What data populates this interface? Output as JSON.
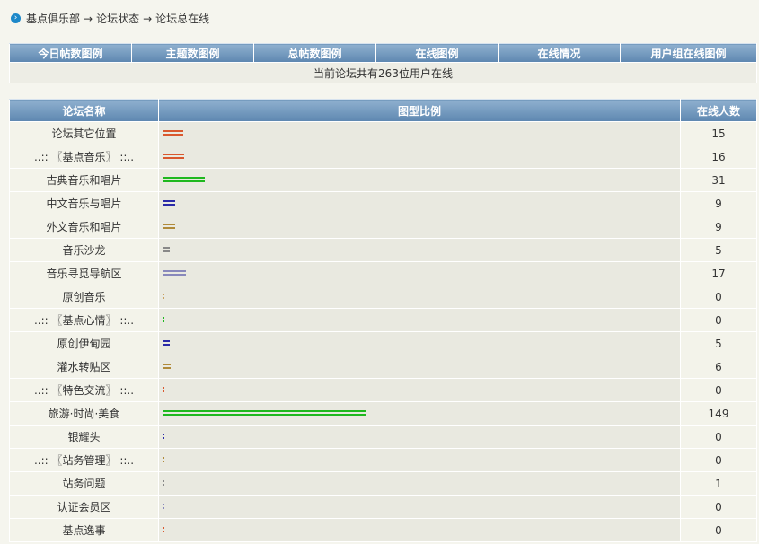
{
  "breadcrumb": {
    "items": [
      "基点俱乐部",
      "论坛状态",
      "论坛总在线"
    ],
    "arrow": "→"
  },
  "nav": {
    "tabs": [
      "今日帖数图例",
      "主题数图例",
      "总帖数图例",
      "在线图例",
      "在线情况",
      "用户组在线图例"
    ],
    "summary": "当前论坛共有263位用户在线"
  },
  "stats": {
    "headers": {
      "name": "论坛名称",
      "chart": "图型比例",
      "count": "在线人数"
    },
    "max_value": 149,
    "rows": [
      {
        "name": "论坛其它位置",
        "count": 15,
        "color": "#d9582e"
      },
      {
        "name": "..:: 〖基点音乐〗 ::..",
        "count": 16,
        "color": "#d9582e"
      },
      {
        "name": "古典音乐和唱片",
        "count": 31,
        "color": "#1fb81f"
      },
      {
        "name": "中文音乐与唱片",
        "count": 9,
        "color": "#2b2ba8"
      },
      {
        "name": "外文音乐和唱片",
        "count": 9,
        "color": "#b08a3a"
      },
      {
        "name": "音乐沙龙",
        "count": 5,
        "color": "#888888"
      },
      {
        "name": "音乐寻觅导航区",
        "count": 17,
        "color": "#8888bb"
      },
      {
        "name": "原创音乐",
        "count": 0,
        "color": "#c8a060"
      },
      {
        "name": "..:: 〖基点心情〗 ::..",
        "count": 0,
        "color": "#1fb81f"
      },
      {
        "name": "原创伊甸园",
        "count": 5,
        "color": "#2b2ba8"
      },
      {
        "name": "灌水转贴区",
        "count": 6,
        "color": "#b08a3a"
      },
      {
        "name": "..:: 〖特色交流〗 ::..",
        "count": 0,
        "color": "#d9582e"
      },
      {
        "name": "旅游·时尚·美食",
        "count": 149,
        "color": "#1fb81f"
      },
      {
        "name": "银耀头",
        "count": 0,
        "color": "#2b2ba8"
      },
      {
        "name": "..:: 〖站务管理〗 ::..",
        "count": 0,
        "color": "#b08a3a"
      },
      {
        "name": "站务问题",
        "count": 1,
        "color": "#888888"
      },
      {
        "name": "认证会员区",
        "count": 0,
        "color": "#8888bb"
      },
      {
        "name": "基点逸事",
        "count": 0,
        "color": "#d9582e"
      }
    ]
  }
}
